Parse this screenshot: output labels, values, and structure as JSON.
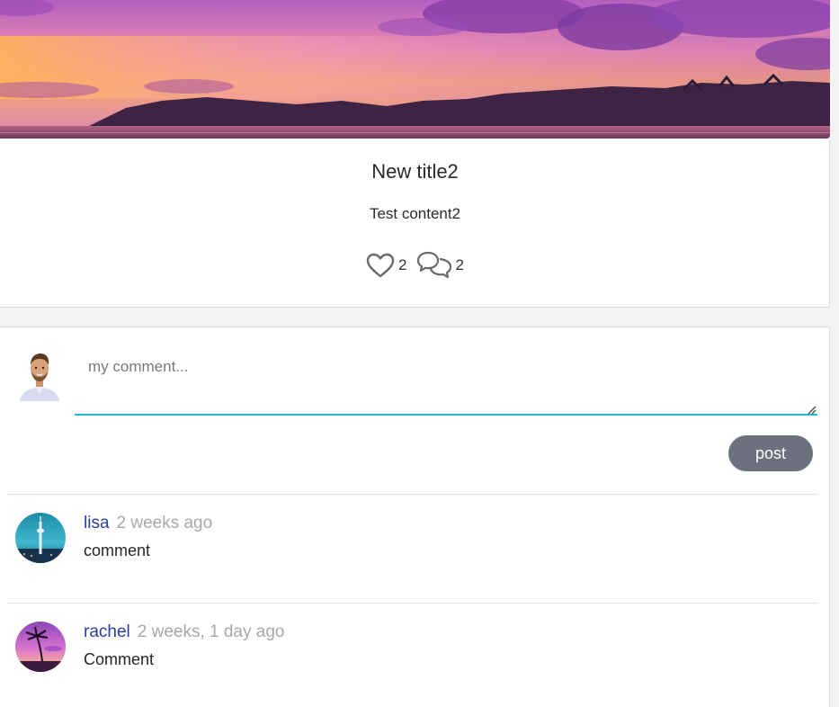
{
  "post": {
    "title": "New title2",
    "content": "Test content2",
    "likes": "2",
    "comments": "2",
    "like_icon": "heart-icon",
    "comment_icon": "chat-bubbles-icon"
  },
  "composer": {
    "placeholder": "my comment...",
    "post_label": "post",
    "accent": "#22b8d0",
    "button_color": "#6d717d"
  },
  "comments": [
    {
      "user": "lisa",
      "time": "2 weeks ago",
      "text": "comment"
    },
    {
      "user": "rachel",
      "time": "2 weeks, 1 day ago",
      "text": "Comment"
    }
  ],
  "colors": {
    "username": "#2c3e9c",
    "timestamp": "#a8a8a8"
  }
}
